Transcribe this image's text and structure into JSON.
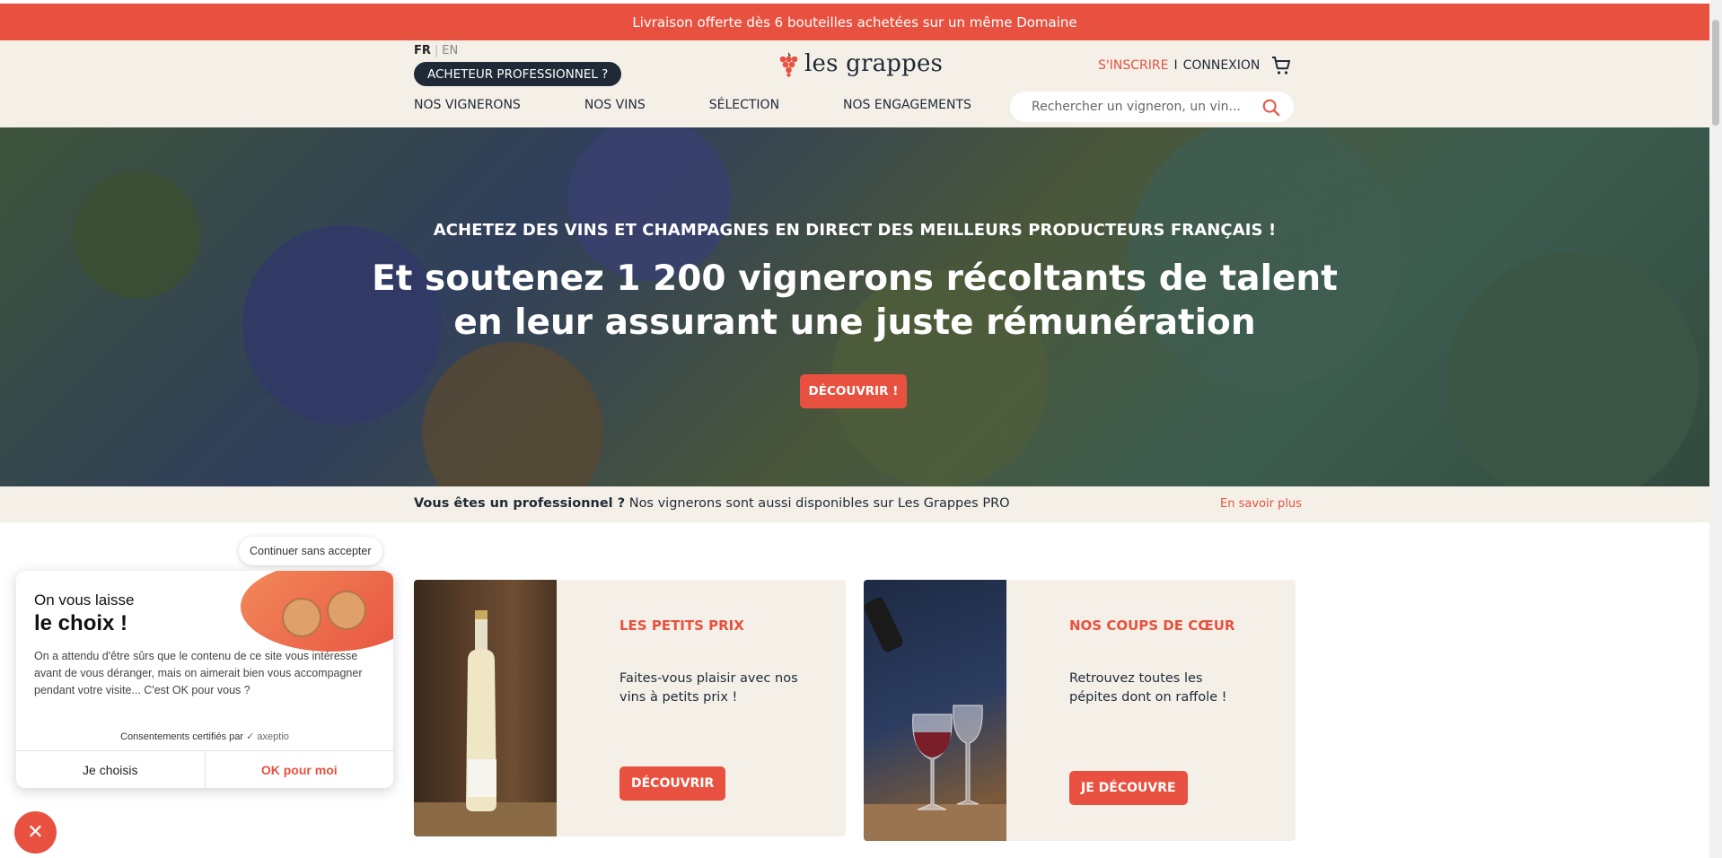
{
  "promo": {
    "text": "Livraison offerte dès 6 bouteilles achetées sur un même Domaine"
  },
  "header": {
    "lang_fr": "FR",
    "lang_en": "EN",
    "pro_button": "ACHETEUR PROFESSIONNEL ?",
    "logo": "les grappes",
    "signup": "S'INSCRIRE",
    "separator": "I",
    "login": "CONNEXION",
    "cart_icon": "shopping-cart-icon",
    "nav": [
      "NOS VIGNERONS",
      "NOS VINS",
      "SÉLECTION",
      "NOS ENGAGEMENTS"
    ],
    "search_placeholder": "Rechercher un vigneron, un vin..."
  },
  "hero": {
    "subtitle": "ACHETEZ DES VINS ET CHAMPAGNES EN DIRECT DES MEILLEURS PRODUCTEURS FRANÇAIS !",
    "title_line1": "Et soutenez 1 200 vignerons récoltants de talent",
    "title_line2": "en leur assurant une juste rémunération",
    "button": "DÉCOUVRIR !"
  },
  "pro_bar": {
    "question": "Vous êtes un professionnel ?",
    "text": " Nos vignerons sont aussi disponibles sur Les Grappes PRO",
    "link": "En savoir plus"
  },
  "cards": [
    {
      "title": "LES PETITS PRIX",
      "text": "Faites-vous plaisir avec nos vins à petits prix !",
      "button": "DÉCOUVRIR"
    },
    {
      "title": "NOS COUPS DE CŒUR",
      "text": "Retrouvez toutes les pépites dont on raffole !",
      "button": "JE DÉCOUVRE"
    }
  ],
  "consent": {
    "continue": "Continuer sans accepter",
    "heading1": "On vous laisse",
    "heading2": "le choix !",
    "body": "On a attendu d'être sûrs que le contenu de ce site vous intéresse avant de vous déranger, mais on aimerait bien vous accompagner pendant votre visite... C'est OK pour vous ?",
    "certified": "Consentements certifiés par",
    "brand": "axeptio",
    "choose": "Je choisis",
    "ok": "OK pour moi"
  },
  "colors": {
    "accent": "#e8513f",
    "dark": "#1f2a36",
    "cream": "#f4f0e8"
  }
}
